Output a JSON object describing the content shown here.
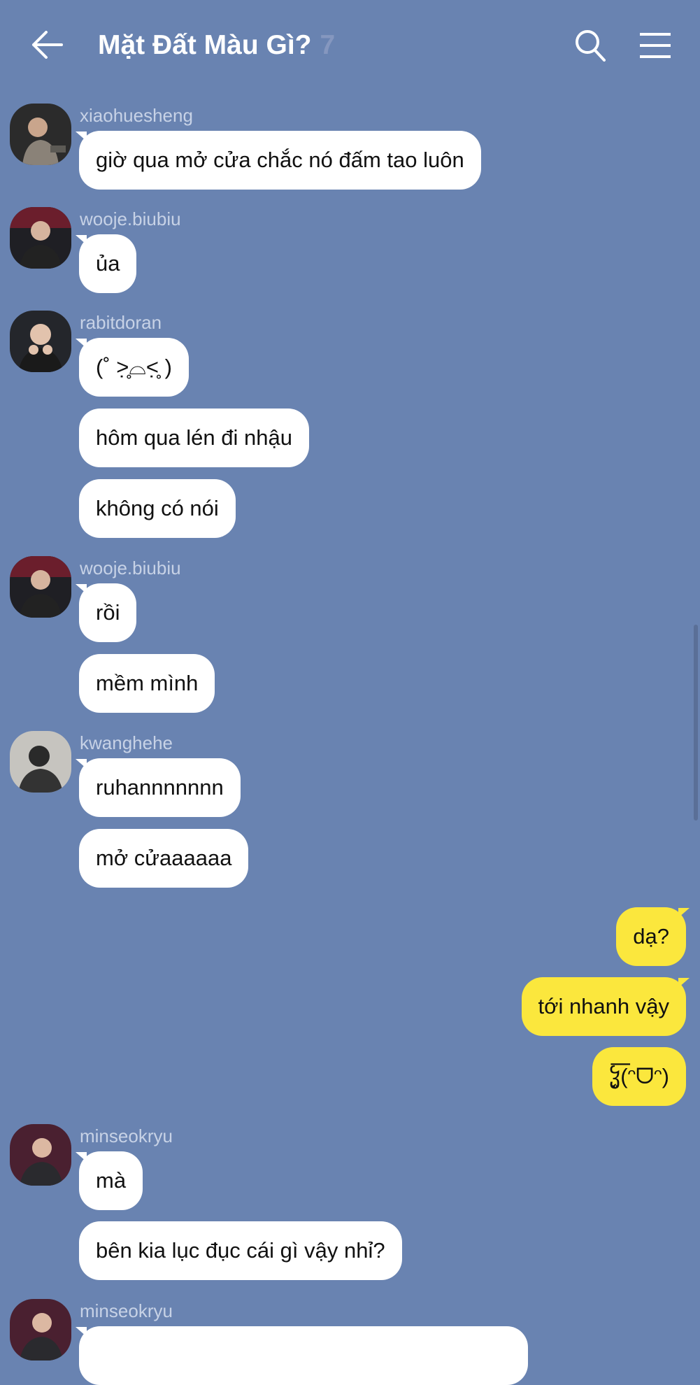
{
  "header": {
    "title": "Mặt Đất Màu Gì?",
    "member_count": "7",
    "back_icon": "arrow-left-icon",
    "search_icon": "search-icon",
    "menu_icon": "hamburger-menu-icon"
  },
  "messages": {
    "g1": {
      "username": "xiaohuesheng",
      "m1": "giờ qua mở cửa chắc nó đấm tao luôn"
    },
    "g2": {
      "username": "wooje.biubiu",
      "m1": "ủa"
    },
    "g3": {
      "username": "rabitdoran",
      "m1": "(˚ ˃̣̣̥⌓˂̣̣̥ )",
      "m2": "hôm qua lén đi nhậu",
      "m3": "không có nói"
    },
    "g4": {
      "username": "wooje.biubiu",
      "m1": "rồi",
      "m2": "mềm mình"
    },
    "g5": {
      "username": "kwanghehe",
      "m1": "ruhannnnnnn",
      "m2": "mở cửaaaaaa"
    },
    "mine": {
      "m1": "dạ?",
      "m2": "tới nhanh vậy",
      "m3": "ჴ̜̤͞(ᵔᗜᵔ)"
    },
    "g6": {
      "username": "minseokryu",
      "m1": "mà",
      "m2": "bên kia lục đục cái gì vậy nhỉ?"
    },
    "g7": {
      "username": "minseokryu"
    }
  },
  "colors": {
    "background": "#6983b1",
    "incoming_bubble": "#ffffff",
    "outgoing_bubble": "#fbe73d",
    "username": "#c7d2e6"
  }
}
